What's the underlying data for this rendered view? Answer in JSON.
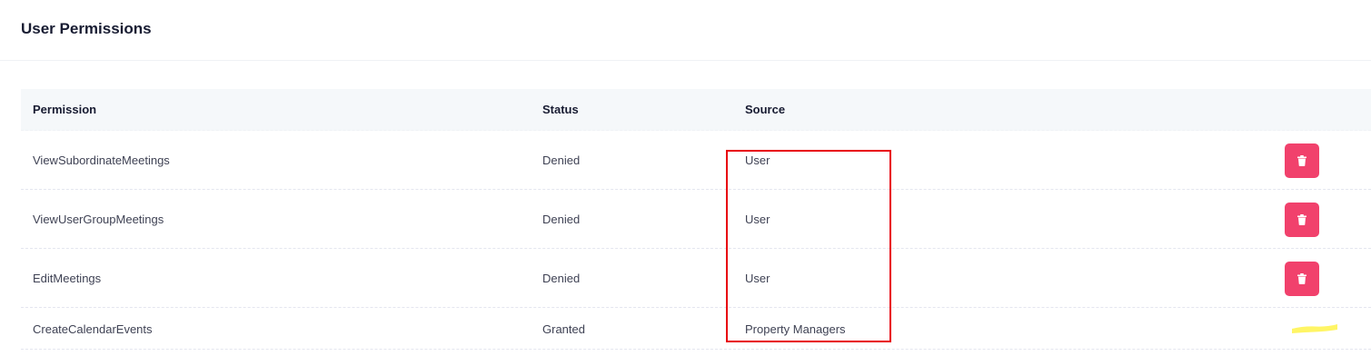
{
  "card": {
    "title": "User Permissions"
  },
  "table": {
    "headers": {
      "permission": "Permission",
      "status": "Status",
      "source": "Source"
    },
    "rows": [
      {
        "permission": "ViewSubordinateMeetings",
        "status": "Denied",
        "source": "User",
        "has_delete": true
      },
      {
        "permission": "ViewUserGroupMeetings",
        "status": "Denied",
        "source": "User",
        "has_delete": true
      },
      {
        "permission": "EditMeetings",
        "status": "Denied",
        "source": "User",
        "has_delete": true
      },
      {
        "permission": "CreateCalendarEvents",
        "status": "Granted",
        "source": "Property Managers",
        "has_delete": false
      }
    ]
  },
  "icons": {
    "delete": "trash-icon"
  },
  "colors": {
    "danger": "#f1416c",
    "header_bg": "#f5f8fa",
    "annotation_red": "#e8000b",
    "annotation_yellow": "#fff34a"
  }
}
